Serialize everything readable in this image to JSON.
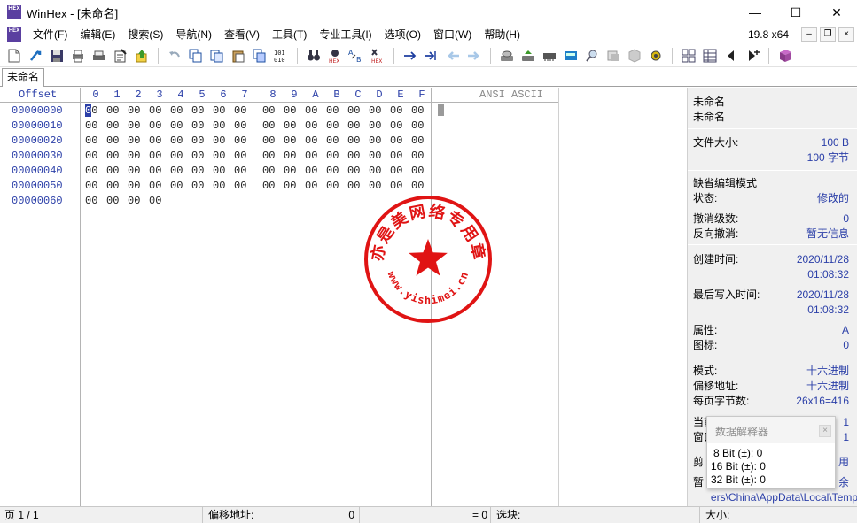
{
  "window": {
    "title": "WinHex - [未命名]",
    "app_icon_text": "HEX",
    "minimize": "—",
    "maximize": "☐",
    "close": "✕"
  },
  "menu": {
    "items": [
      "文件(F)",
      "编辑(E)",
      "搜索(S)",
      "导航(N)",
      "查看(V)",
      "工具(T)",
      "专业工具(I)",
      "选项(O)",
      "窗口(W)",
      "帮助(H)"
    ],
    "zoom": "19.8 x64",
    "mdi_minimize": "–",
    "mdi_restore": "❐",
    "mdi_close": "×"
  },
  "toolbar": {
    "icons": [
      "new-icon",
      "open-icon",
      "save-icon",
      "print-icon",
      "print-setup-icon",
      "properties-icon",
      "export-icon",
      "undo-icon",
      "copy-icon",
      "cut-icon",
      "paste-icon",
      "paste-write-icon",
      "copy-hex-icon",
      "find-icon",
      "find-hex-icon",
      "replace-icon",
      "replace-hex-icon",
      "goto-offset-icon",
      "goto-sector-icon",
      "back-icon",
      "forward-icon",
      "disk-icon",
      "open-disk-icon",
      "ram-icon",
      "calculator-icon",
      "search-icon",
      "hash-icon",
      "bookmark-icon",
      "settings-icon",
      "grid-icon",
      "table-icon",
      "prev-icon",
      "next-icon",
      "book-icon"
    ]
  },
  "tab": {
    "label": "未命名"
  },
  "hex": {
    "offset_header": "Offset",
    "col_headers": [
      "0",
      "1",
      "2",
      "3",
      "4",
      "5",
      "6",
      "7",
      "8",
      "9",
      "A",
      "B",
      "C",
      "D",
      "E",
      "F"
    ],
    "ansi_header": "ANSI ASCII",
    "rows": [
      {
        "offset": "00000000",
        "bytes": [
          "00",
          "00",
          "00",
          "00",
          "00",
          "00",
          "00",
          "00",
          "00",
          "00",
          "00",
          "00",
          "00",
          "00",
          "00",
          "00"
        ]
      },
      {
        "offset": "00000010",
        "bytes": [
          "00",
          "00",
          "00",
          "00",
          "00",
          "00",
          "00",
          "00",
          "00",
          "00",
          "00",
          "00",
          "00",
          "00",
          "00",
          "00"
        ]
      },
      {
        "offset": "00000020",
        "bytes": [
          "00",
          "00",
          "00",
          "00",
          "00",
          "00",
          "00",
          "00",
          "00",
          "00",
          "00",
          "00",
          "00",
          "00",
          "00",
          "00"
        ]
      },
      {
        "offset": "00000030",
        "bytes": [
          "00",
          "00",
          "00",
          "00",
          "00",
          "00",
          "00",
          "00",
          "00",
          "00",
          "00",
          "00",
          "00",
          "00",
          "00",
          "00"
        ]
      },
      {
        "offset": "00000040",
        "bytes": [
          "00",
          "00",
          "00",
          "00",
          "00",
          "00",
          "00",
          "00",
          "00",
          "00",
          "00",
          "00",
          "00",
          "00",
          "00",
          "00"
        ]
      },
      {
        "offset": "00000050",
        "bytes": [
          "00",
          "00",
          "00",
          "00",
          "00",
          "00",
          "00",
          "00",
          "00",
          "00",
          "00",
          "00",
          "00",
          "00",
          "00",
          "00"
        ]
      },
      {
        "offset": "00000060",
        "bytes": [
          "00",
          "00",
          "00",
          "00"
        ]
      }
    ]
  },
  "info": {
    "name1": "未命名",
    "name2": "未命名",
    "file_size_label": "文件大小:",
    "file_size_bytes": "100 B",
    "file_size_cn": "100 字节",
    "edit_mode_label": "缺省编辑模式",
    "state_label": "状态:",
    "state_value": "修改的",
    "undo_level_label": "撤消级数:",
    "undo_level_value": "0",
    "reverse_undo_label": "反向撤消:",
    "reverse_undo_value": "暂无信息",
    "created_label": "创建时间:",
    "created_date": "2020/11/28",
    "created_time": "01:08:32",
    "modified_label": "最后写入时间:",
    "modified_date": "2020/11/28",
    "modified_time": "01:08:32",
    "attr_label": "属性:",
    "attr_value": "A",
    "icon_label": "图标:",
    "icon_value": "0",
    "mode_label": "模式:",
    "mode_value": "十六进制",
    "offset_label": "偏移地址:",
    "offset_value": "十六进制",
    "bytes_per_page_label": "每页字节数:",
    "bytes_per_page_value": "26x16=416",
    "current_label_partial": "当前",
    "current_value": "1",
    "window_label_partial": "窗口",
    "window_value": "1",
    "clipboard_label_partial": "剪",
    "clipboard_value_partial": "用",
    "temp_label_partial": "暂",
    "temp_value_partial": "余",
    "temp_path": "ers\\China\\AppData\\Local\\Temp"
  },
  "interpreter": {
    "title": "数据解释器",
    "close": "×",
    "rows": [
      "8 Bit (±): 0",
      "16 Bit (±): 0",
      "32 Bit (±): 0"
    ]
  },
  "stamp": {
    "top_text": "亦是美网络专用章",
    "bottom_text": "www.yishimei.cn",
    "color": "#e01414"
  },
  "status": {
    "page": "页 1 / 1",
    "offset_label": "偏移地址:",
    "offset_value": "0",
    "equals": "= 0",
    "selection_label": "选块:",
    "size_label": "大小:"
  },
  "colors": {
    "accent_blue": "#2b3fa8",
    "panel_bg": "#f0f0f0"
  }
}
